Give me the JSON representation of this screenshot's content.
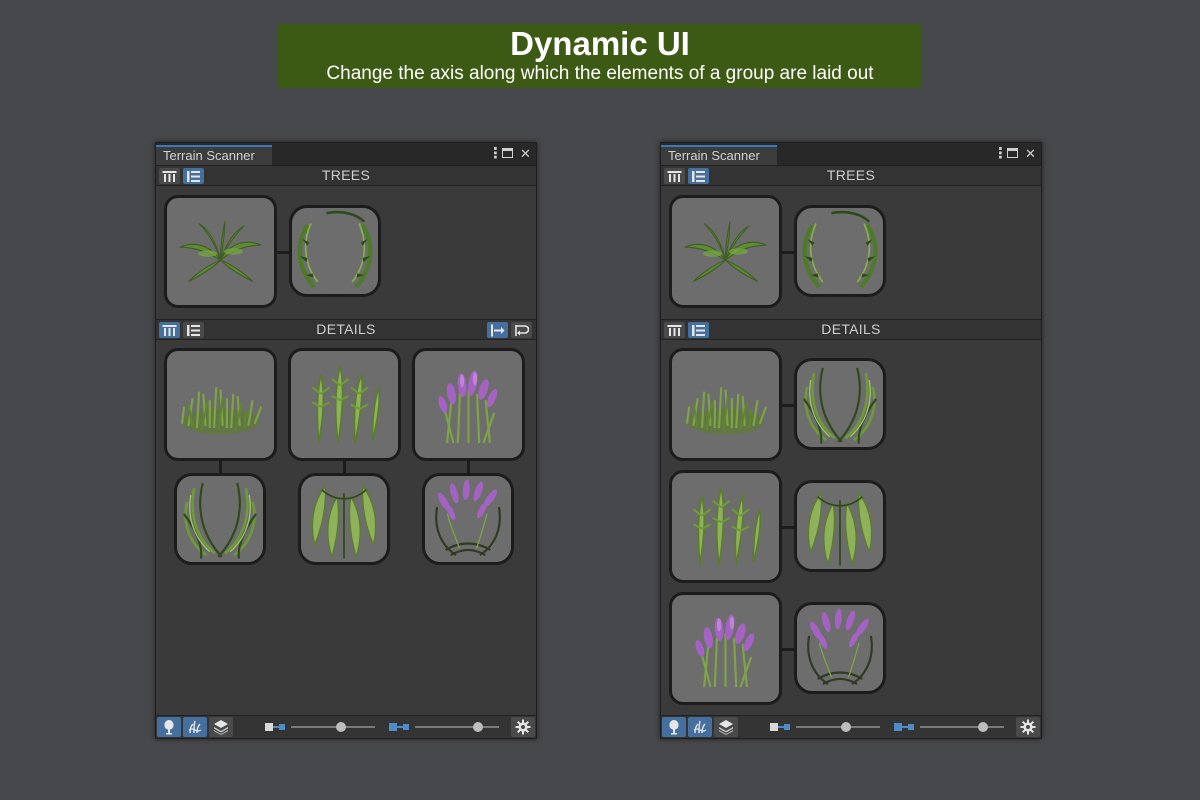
{
  "banner": {
    "title": "Dynamic UI",
    "subtitle": "Change the axis along which the elements of a group are laid out"
  },
  "window": {
    "tab_label": "Terrain Scanner",
    "buttons": {
      "menu": "⋮",
      "close": "✕"
    }
  },
  "sections": {
    "trees": {
      "title": "TREES"
    },
    "details": {
      "title": "DETAILS"
    }
  },
  "toolbar": {
    "left_slider_value": 0.6,
    "right_slider_value": 0.75
  },
  "colors": {
    "banner_bg": "#3d5a14",
    "accent_blue": "#456f9e",
    "tab_accent": "#3a79bb",
    "node_bg": "#6d6d6d",
    "grass": "#6e8f3a",
    "flower": "#a463c2"
  },
  "icons": {
    "layout_columns": "columns-layout-icon",
    "layout_list": "list-layout-icon",
    "axis": "axis-horizontal-icon",
    "wrap": "wrap-icon",
    "tree": "tree-icon",
    "grass": "grass-icon",
    "layers": "layers-icon",
    "settings": "gear-icon"
  }
}
